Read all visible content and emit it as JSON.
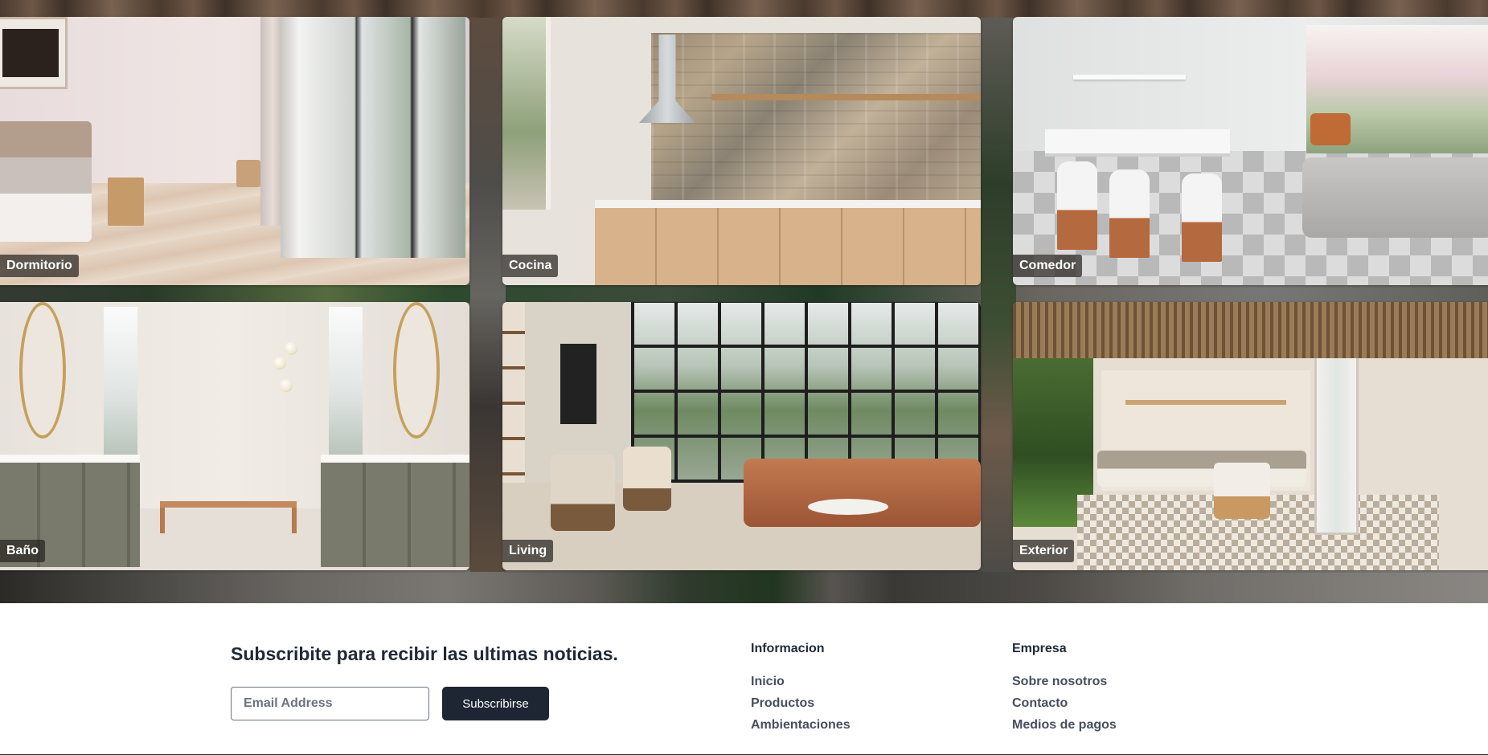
{
  "gallery": {
    "tiles": [
      {
        "label": "Dormitorio"
      },
      {
        "label": "Cocina"
      },
      {
        "label": "Comedor"
      },
      {
        "label": "Baño"
      },
      {
        "label": "Living"
      },
      {
        "label": "Exterior"
      }
    ]
  },
  "footer": {
    "subscribe_title": "Subscribite para recibir las ultimas noticias.",
    "email_placeholder": "Email Address",
    "subscribe_button": "Subscribirse",
    "columns": [
      {
        "heading": "Informacion",
        "links": [
          "Inicio",
          "Productos",
          "Ambientaciones"
        ]
      },
      {
        "heading": "Empresa",
        "links": [
          "Sobre nosotros",
          "Contacto",
          "Medios de pagos"
        ]
      }
    ]
  },
  "colors": {
    "button_bg": "#1e2533",
    "text_dark": "#1f2937",
    "label_bg": "rgba(40,36,32,0.72)"
  }
}
